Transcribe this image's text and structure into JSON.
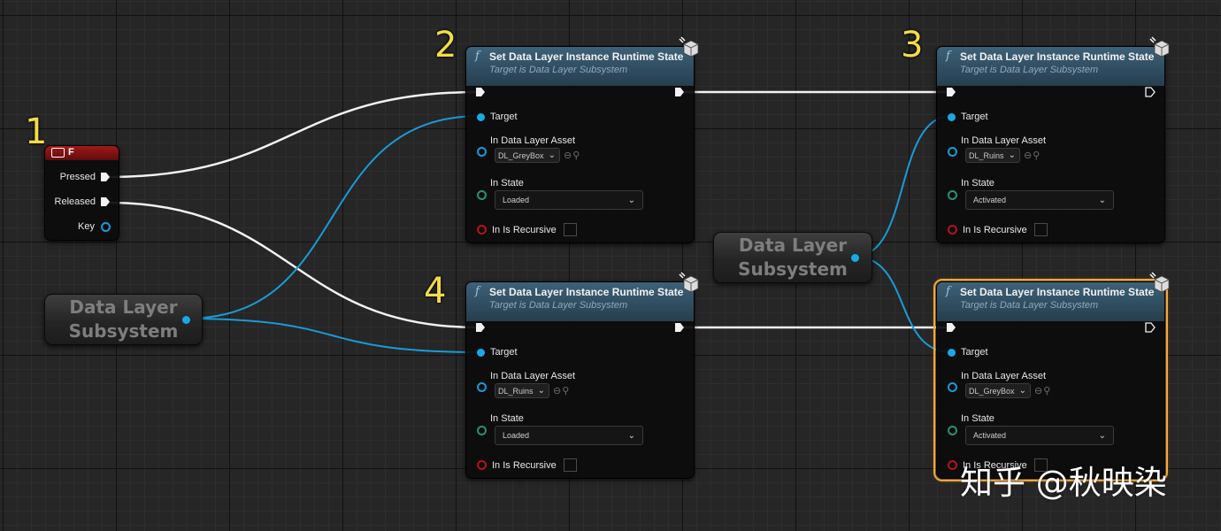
{
  "step_labels": [
    "1",
    "2",
    "3",
    "4"
  ],
  "key_event": {
    "key": "F",
    "icon": "keyboard-icon",
    "pins": {
      "pressed": "Pressed",
      "released": "Released",
      "key": "Key"
    }
  },
  "getters": [
    {
      "line1": "Data Layer",
      "line2": "Subsystem"
    },
    {
      "line1": "Data Layer",
      "line2": "Subsystem"
    }
  ],
  "function_nodes": [
    {
      "title": "Set Data Layer Instance Runtime State",
      "subtitle": "Target is Data Layer Subsystem",
      "target_label": "Target",
      "asset_label": "In Data Layer Asset",
      "asset_value": "DL_GreyBox",
      "state_label": "In State",
      "state_value": "Loaded",
      "recursive_label": "In Is Recursive",
      "selected": false
    },
    {
      "title": "Set Data Layer Instance Runtime State",
      "subtitle": "Target is Data Layer Subsystem",
      "target_label": "Target",
      "asset_label": "In Data Layer Asset",
      "asset_value": "DL_Ruins",
      "state_label": "In State",
      "state_value": "Activated",
      "recursive_label": "In Is Recursive",
      "selected": false
    },
    {
      "title": "Set Data Layer Instance Runtime State",
      "subtitle": "Target is Data Layer Subsystem",
      "target_label": "Target",
      "asset_label": "In Data Layer Asset",
      "asset_value": "DL_Ruins",
      "state_label": "In State",
      "state_value": "Loaded",
      "recursive_label": "In Is Recursive",
      "selected": false
    },
    {
      "title": "Set Data Layer Instance Runtime State",
      "subtitle": "Target is Data Layer Subsystem",
      "target_label": "Target",
      "asset_label": "In Data Layer Asset",
      "asset_value": "DL_GreyBox",
      "state_label": "In State",
      "state_value": "Activated",
      "recursive_label": "In Is Recursive",
      "selected": true
    }
  ],
  "watermark": "知乎 @秋映染",
  "colors": {
    "exec_wire": "#f2f2f2",
    "object_wire": "#1b9ad6",
    "selection": "#f2a83a",
    "step_number": "#f3dc4a",
    "key_header": "#a21a1a",
    "function_header": "#3d6178"
  }
}
